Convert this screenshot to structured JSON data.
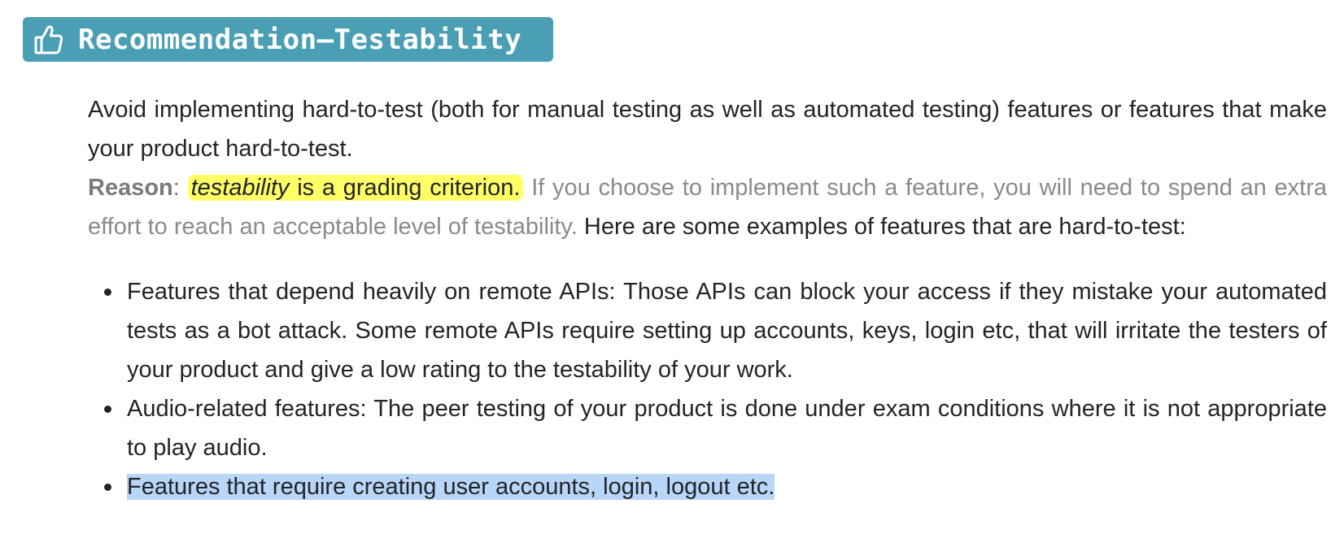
{
  "badge": {
    "icon": "thumbs-up-icon",
    "color": "#4a9fb5",
    "title": "Recommendation–Testability"
  },
  "intro": {
    "text": "Avoid implementing hard-to-test (both for manual testing as well as automated testing) features or features that make your product hard-to-test."
  },
  "reason": {
    "label": "Reason",
    "colon": ":",
    "highlight_italic": "testability",
    "highlight_rest": " is a grading criterion.",
    "highlight_color": "#ffff66",
    "muted_text": "If you choose to implement such a feature, you will need to spend an extra effort to reach an acceptable level of testability.",
    "tail_text": "Here are some examples of features that are hard-to-test:"
  },
  "examples": [
    {
      "text": "Features that depend heavily on remote APIs: Those APIs can block your access if they mistake your automated tests as a bot attack. Some remote APIs require setting up accounts, keys, login etc, that will irritate the testers of your product and give a low rating to the testability of your work."
    },
    {
      "text": "Audio-related features: The peer testing of your product is done under exam conditions where it is not appropriate to play audio."
    },
    {
      "text": "Features that require creating user accounts, login, logout etc."
    }
  ],
  "selection_color": "#b9d5f7"
}
